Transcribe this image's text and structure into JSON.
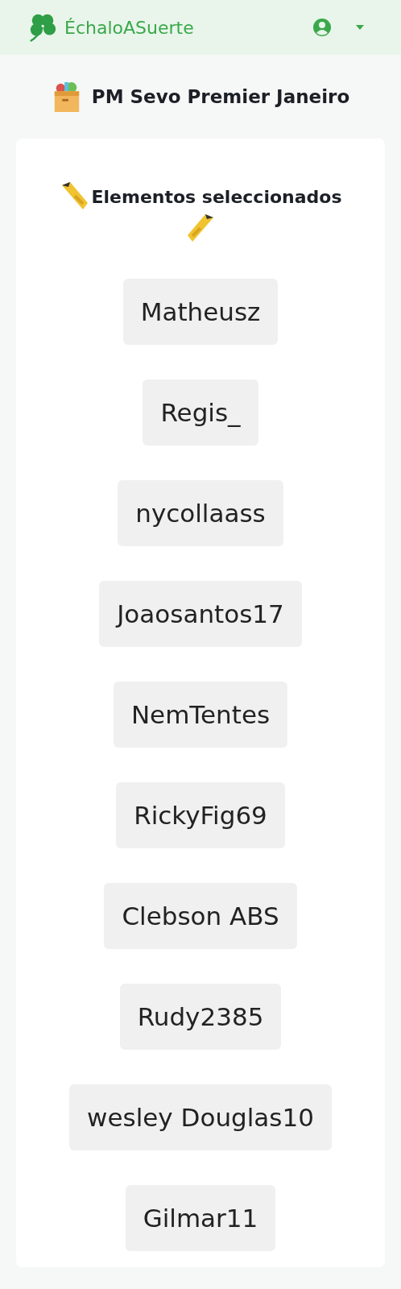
{
  "header": {
    "brand": "ÉchaloASuerte"
  },
  "title": "PM Sevo Premier Janeiro",
  "card": {
    "heading": "Elementos seleccionados",
    "items": [
      "Matheusz",
      "Regis_",
      "nycollaass",
      "Joaosantos17",
      "NemTentes",
      "RickyFig69",
      "Clebson ABS",
      "Rudy2385",
      "wesley Douglas10",
      "Gilmar11"
    ]
  }
}
